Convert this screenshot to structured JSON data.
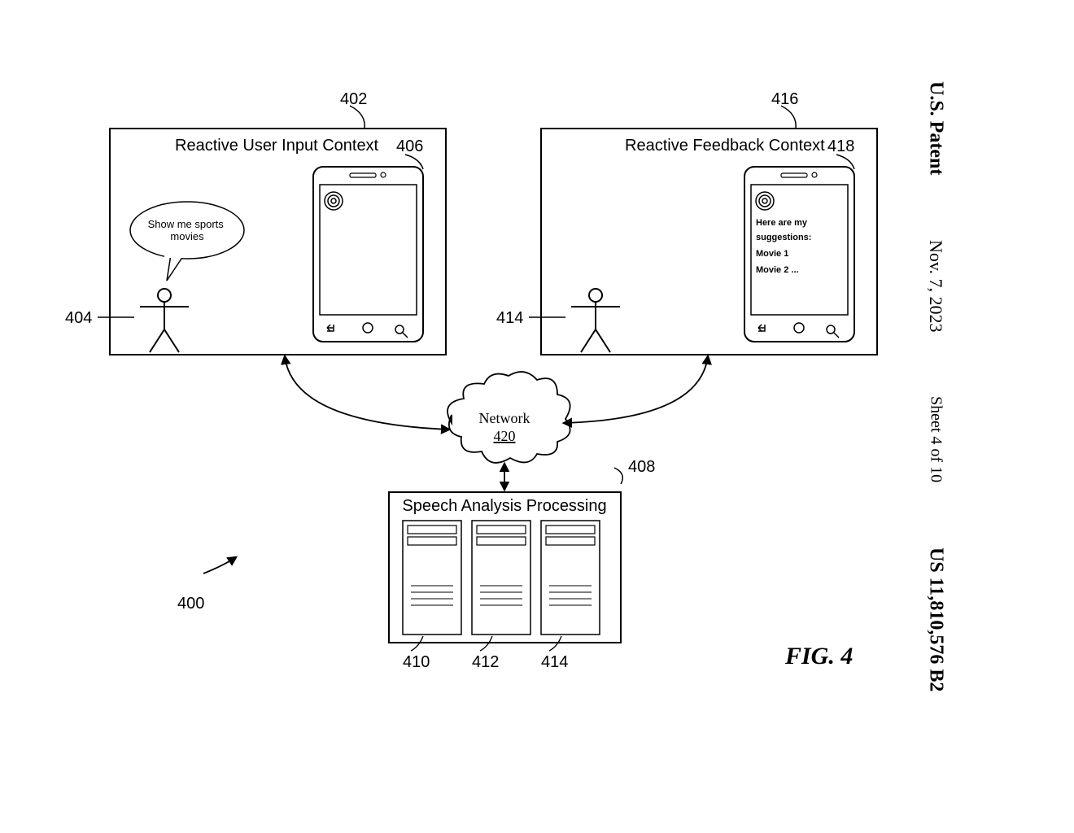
{
  "header": {
    "authority": "U.S. Patent",
    "date": "Nov. 7, 2023",
    "sheet": "Sheet 4 of 10",
    "patent_no": "US 11,810,576 B2"
  },
  "figure": {
    "caption": "FIG. 4",
    "overall_ref": "400"
  },
  "left_panel": {
    "ref": "402",
    "title": "Reactive User Input Context",
    "user_ref": "404",
    "phone_ref": "406",
    "speech": "Show me sports movies"
  },
  "right_panel": {
    "ref": "416",
    "title": "Reactive Feedback Context",
    "user_ref": "414",
    "phone_ref": "418",
    "phone_lines": [
      "Here are my",
      "suggestions:",
      "Movie 1",
      "Movie 2 ..."
    ]
  },
  "network": {
    "label": "Network",
    "ref": "420"
  },
  "processing": {
    "ref": "408",
    "title": "Speech Analysis Processing",
    "server_refs": [
      "410",
      "412",
      "414"
    ]
  }
}
